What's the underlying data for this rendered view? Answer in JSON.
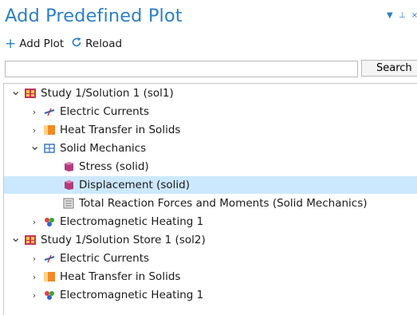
{
  "panel": {
    "title": "Add Predefined Plot"
  },
  "toolbar": {
    "add_plot_label": "Add Plot",
    "reload_label": "Reload"
  },
  "search": {
    "value": "",
    "button_label": "Search"
  },
  "tree": {
    "rows": [
      {
        "label": "Study 1/Solution 1 (sol1)",
        "caret": "down",
        "icon": "study-solution-icon",
        "selected": false
      },
      {
        "label": "Electric Currents",
        "caret": "right",
        "icon": "electric-currents-icon",
        "selected": false
      },
      {
        "label": "Heat Transfer in Solids",
        "caret": "right",
        "icon": "heat-transfer-icon",
        "selected": false
      },
      {
        "label": "Solid Mechanics",
        "caret": "down",
        "icon": "solid-mechanics-icon",
        "selected": false
      },
      {
        "label": "Stress (solid)",
        "caret": "",
        "icon": "plot-group-icon",
        "selected": false
      },
      {
        "label": "Displacement (solid)",
        "caret": "",
        "icon": "plot-group-icon",
        "selected": true
      },
      {
        "label": "Total Reaction Forces and Moments (Solid Mechanics)",
        "caret": "",
        "icon": "table-evaluation-icon",
        "selected": false
      },
      {
        "label": "Electromagnetic Heating 1",
        "caret": "right",
        "icon": "multiphysics-icon",
        "selected": false
      },
      {
        "label": "Study 1/Solution Store 1 (sol2)",
        "caret": "down",
        "icon": "study-solution-icon",
        "selected": false
      },
      {
        "label": "Electric Currents",
        "caret": "right",
        "icon": "electric-currents-icon",
        "selected": false
      },
      {
        "label": "Heat Transfer in Solids",
        "caret": "right",
        "icon": "heat-transfer-icon",
        "selected": false
      },
      {
        "label": "Electromagnetic Heating 1",
        "caret": "right",
        "icon": "multiphysics-icon",
        "selected": false
      }
    ]
  },
  "colors": {
    "accent": "#2b7fc9",
    "selection": "#cce8ff"
  }
}
